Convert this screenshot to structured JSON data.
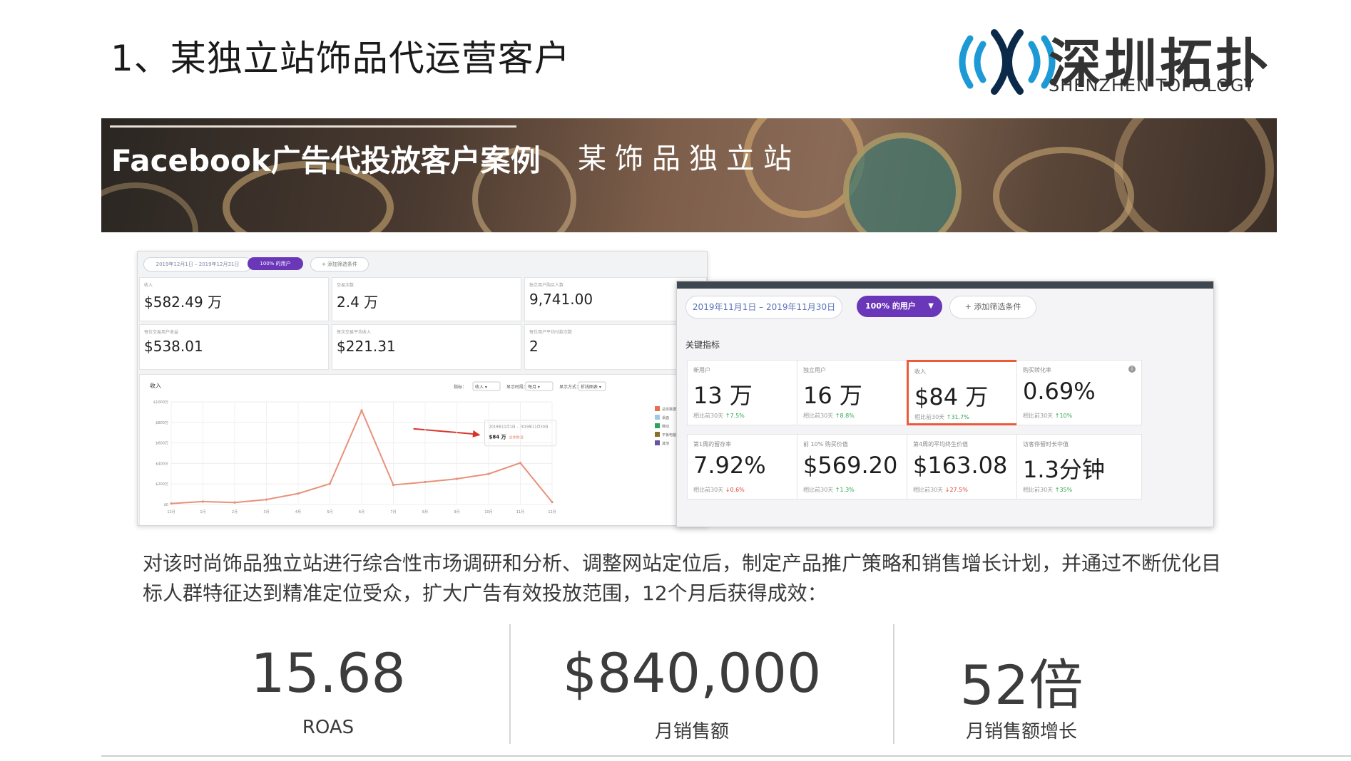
{
  "title": "1、某独立站饰品代运营客户",
  "logo": {
    "cn": "深圳拓扑",
    "en": "SHENZHEN TOPOLOGY",
    "colors": [
      "#1d9ad6",
      "#0b2a4a"
    ]
  },
  "banner": {
    "title": "Facebook广告代投放客户案例",
    "subtitle": "某饰品独立站"
  },
  "left_dashboard": {
    "date_range": "2019年12月1日 – 2019年12月31日",
    "segment": "100% 的用户",
    "add_filter": "+ 添加筛选条件",
    "metrics": [
      {
        "label": "收入",
        "value": "$582.49 万"
      },
      {
        "label": "交易次数",
        "value": "2.4 万"
      },
      {
        "label": "独立用户购买人数",
        "value": "9,741.00"
      },
      {
        "label": "每位交易用户收益",
        "value": "$538.01"
      },
      {
        "label": "每次交易平均收入",
        "value": "$221.31"
      },
      {
        "label": "每位用户平均付款次数",
        "value": "2"
      }
    ],
    "chart": {
      "title": "收入",
      "controls": [
        "指标：",
        "收入 ▾",
        "显示时段：",
        "每月 ▾",
        "显示方式：",
        "折线图表 ▾"
      ],
      "tooltip": {
        "date": "2019年11月1日 – 2019年11月30日",
        "value": "$84 万",
        "label": "总体数据"
      },
      "legend": [
        "总体数据",
        "桌面",
        "移动",
        "平板电脑",
        "其他"
      ],
      "legend_colors": [
        "#e76f51",
        "#9ecae1",
        "#2ca25f",
        "#8c6d31",
        "#6a51a3"
      ]
    }
  },
  "chart_data": {
    "type": "line",
    "x": [
      "12月",
      "1月",
      "2月",
      "3月",
      "4月",
      "5月",
      "6月",
      "7月",
      "8月",
      "9月",
      "10月",
      "11月",
      "12月"
    ],
    "series": [
      {
        "values": [
          4,
          12,
          8,
          20,
          45,
          85,
          385,
          80,
          92,
          105,
          125,
          170,
          10
        ]
      }
    ],
    "y_ticks": [
      "$1000万",
      "$800万",
      "$600万",
      "$400万",
      "$200万",
      "$0"
    ],
    "ylim": [
      0,
      420
    ],
    "grid": true,
    "legend": "right"
  },
  "right_dashboard": {
    "date_range": "2019年11月1日 – 2019年11月30日",
    "segment": "100% 的用户",
    "add_filter": "添加筛选条件",
    "section_title": "关键指标",
    "cards": [
      {
        "label": "新用户",
        "value": "13 万",
        "compare": "相比前30天",
        "delta": "7.5%",
        "dir": "up",
        "highlight": false,
        "info": false
      },
      {
        "label": "独立用户",
        "value": "16 万",
        "compare": "相比前30天",
        "delta": "8.8%",
        "dir": "up",
        "highlight": false,
        "info": false
      },
      {
        "label": "收入",
        "value": "$84 万",
        "compare": "相比前30天",
        "delta": "31.7%",
        "dir": "up",
        "highlight": true,
        "info": false
      },
      {
        "label": "购买转化率",
        "value": "0.69%",
        "compare": "相比前30天",
        "delta": "10%",
        "dir": "up",
        "highlight": false,
        "info": true
      },
      {
        "label": "第1周的留存率",
        "value": "7.92%",
        "compare": "相比前30天",
        "delta": "0.6%",
        "dir": "down",
        "highlight": false,
        "info": false
      },
      {
        "label": "前 10% 购买价值",
        "value": "$569.20",
        "compare": "相比前30天",
        "delta": "1.3%",
        "dir": "up",
        "highlight": false,
        "info": true
      },
      {
        "label": "第4周的平均终生价值",
        "value": "$163.08",
        "compare": "相比前30天",
        "delta": "27.5%",
        "dir": "down",
        "highlight": false,
        "info": false
      },
      {
        "label": "访客停留时长中值",
        "value": "1.3分钟",
        "compare": "相比前30天",
        "delta": "35%",
        "dir": "up",
        "highlight": false,
        "info": false
      }
    ]
  },
  "description": "对该时尚饰品独立站进行综合性市场调研和分析、调整网站定位后，制定产品推广策略和销售增长计划，并通过不断优化目标人群特征达到精准定位受众，扩大广告有效投放范围，12个月后获得成效：",
  "stats": [
    {
      "value": "15.68",
      "label": "ROAS"
    },
    {
      "value": "$840,000",
      "label": "月销售额"
    },
    {
      "value": "52倍",
      "label": "月销售额增长"
    }
  ]
}
